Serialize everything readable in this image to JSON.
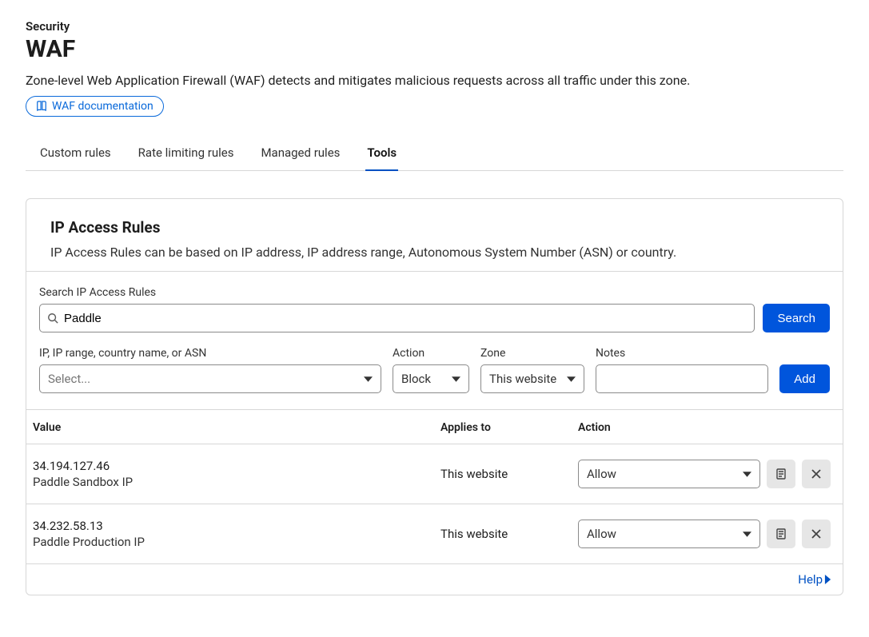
{
  "breadcrumb": "Security",
  "title": "WAF",
  "description": "Zone-level Web Application Firewall (WAF) detects and mitigates malicious requests across all traffic under this zone.",
  "doc_link_label": "WAF documentation",
  "tabs": [
    {
      "label": "Custom rules",
      "active": false
    },
    {
      "label": "Rate limiting rules",
      "active": false
    },
    {
      "label": "Managed rules",
      "active": false
    },
    {
      "label": "Tools",
      "active": true
    }
  ],
  "panel": {
    "title": "IP Access Rules",
    "description": "IP Access Rules can be based on IP address, IP address range, Autonomous System Number (ASN) or country."
  },
  "search": {
    "label": "Search IP Access Rules",
    "value": "Paddle",
    "button": "Search"
  },
  "filters": {
    "ip": {
      "label": "IP, IP range, country name, or ASN",
      "placeholder": "Select...",
      "value": ""
    },
    "action": {
      "label": "Action",
      "value": "Block"
    },
    "zone": {
      "label": "Zone",
      "value": "This website"
    },
    "notes": {
      "label": "Notes",
      "value": ""
    },
    "add_button": "Add"
  },
  "table": {
    "headers": {
      "value": "Value",
      "applies_to": "Applies to",
      "action": "Action"
    },
    "rows": [
      {
        "ip": "34.194.127.46",
        "note": "Paddle Sandbox IP",
        "applies_to": "This website",
        "action": "Allow"
      },
      {
        "ip": "34.232.58.13",
        "note": "Paddle Production IP",
        "applies_to": "This website",
        "action": "Allow"
      }
    ]
  },
  "help_label": "Help"
}
